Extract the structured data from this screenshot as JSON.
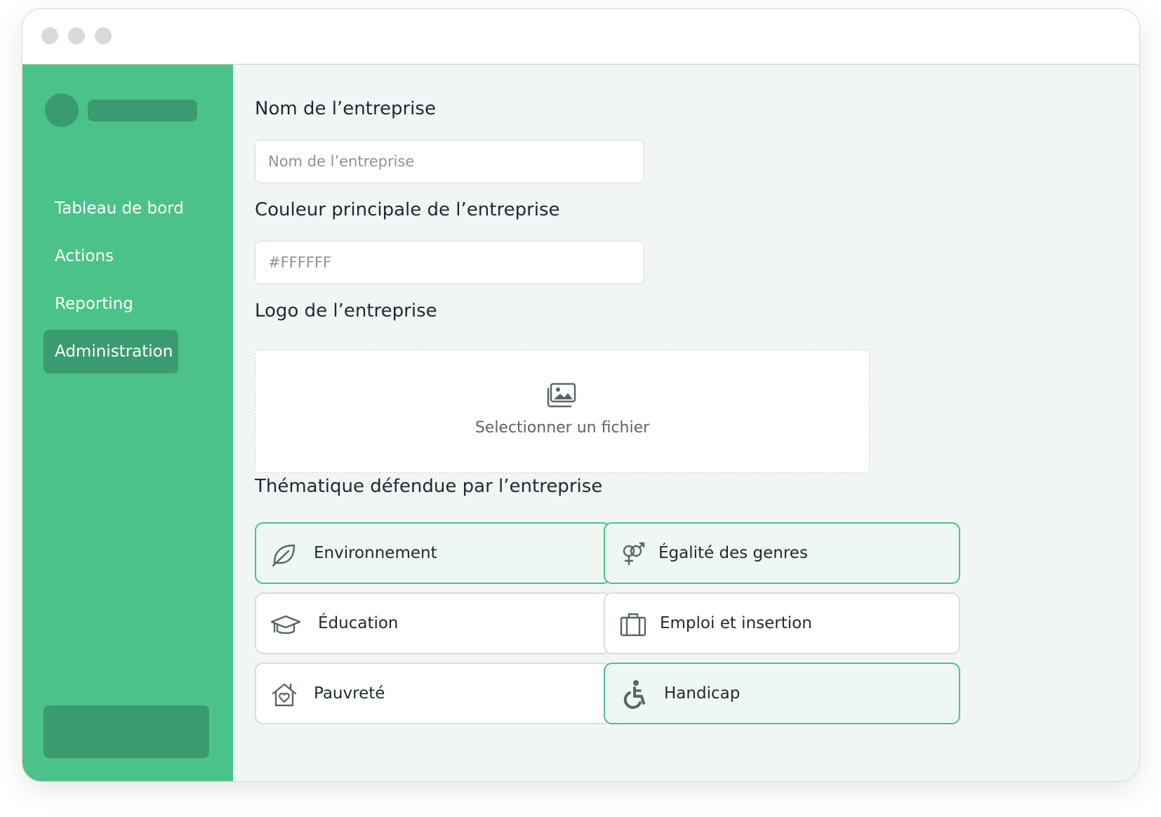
{
  "sidebar": {
    "items": [
      {
        "label": "Tableau de bord",
        "active": false
      },
      {
        "label": "Actions",
        "active": false
      },
      {
        "label": "Reporting",
        "active": false
      },
      {
        "label": "Administration",
        "active": true
      }
    ]
  },
  "form": {
    "company_name": {
      "label": "Nom de l’entreprise",
      "placeholder": "Nom de l’entreprise",
      "value": ""
    },
    "main_color": {
      "label": "Couleur principale de l’entreprise",
      "placeholder": "#FFFFFF",
      "value": ""
    },
    "logo": {
      "label": "Logo de l’entreprise",
      "upload_text": "Selectionner un fichier",
      "icon": "image-gallery-icon"
    },
    "themes": {
      "label": "Thématique défendue par l’entreprise",
      "options": [
        {
          "label": "Environnement",
          "icon": "leaf-icon",
          "selected": true
        },
        {
          "label": "Égalité des genres",
          "icon": "gender-icon",
          "selected": true
        },
        {
          "label": "Éducation",
          "icon": "graduation-cap-icon",
          "selected": false
        },
        {
          "label": "Emploi et insertion",
          "icon": "briefcase-icon",
          "selected": false
        },
        {
          "label": "Pauvreté",
          "icon": "house-heart-icon",
          "selected": false
        },
        {
          "label": "Handicap",
          "icon": "wheelchair-icon",
          "selected": true
        }
      ]
    }
  },
  "colors": {
    "accent": "#4cc28b",
    "accent_dark": "#3a9b70",
    "selected_bg": "#eef7f1",
    "main_bg": "#f2f5f5"
  }
}
